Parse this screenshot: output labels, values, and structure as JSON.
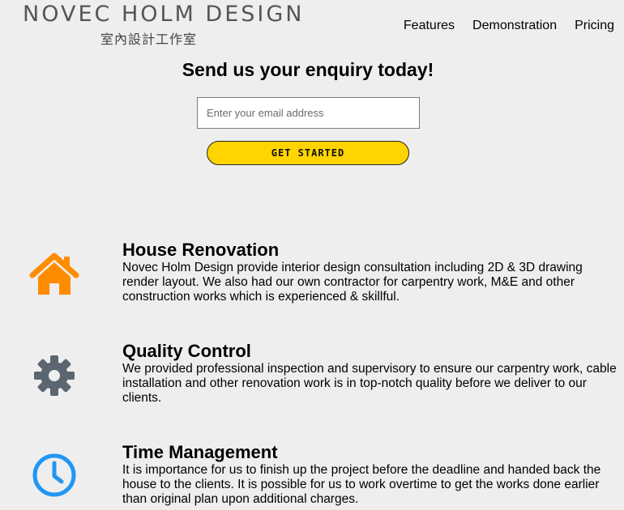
{
  "brand": {
    "logo_main": "NOVEC HOLM DESIGN",
    "logo_sub": "室內設計工作室"
  },
  "nav": {
    "items": [
      "Features",
      "Demonstration",
      "Pricing"
    ]
  },
  "enquiry": {
    "title": "Send us your enquiry today!",
    "email_placeholder": "Enter your email address",
    "email_value": "",
    "button_label": "GET STARTED"
  },
  "features": [
    {
      "icon": "home-icon",
      "title": "House Renovation",
      "description": "Novec Holm Design provide interior design consultation including 2D & 3D drawing render layout. We also had our own contractor for carpentry work, M&E and other construction works which is experienced & skillful."
    },
    {
      "icon": "gear-icon",
      "title": "Quality Control",
      "description": "We provided professional inspection and supervisory to ensure our carpentry work, cable installation and other renovation work is in top-notch quality before we deliver to our clients."
    },
    {
      "icon": "clock-icon",
      "title": "Time Management",
      "description": "It is importance for us to finish up the project before the deadline and handed back the house to the clients. It is possible for us to work overtime to get the works done earlier than original plan upon additional charges."
    }
  ],
  "colors": {
    "background": "#eeeeee",
    "button": "#ffd400",
    "home_icon": "#ff8c00",
    "gear_icon": "#5c6670",
    "clock_icon": "#2196f3"
  }
}
